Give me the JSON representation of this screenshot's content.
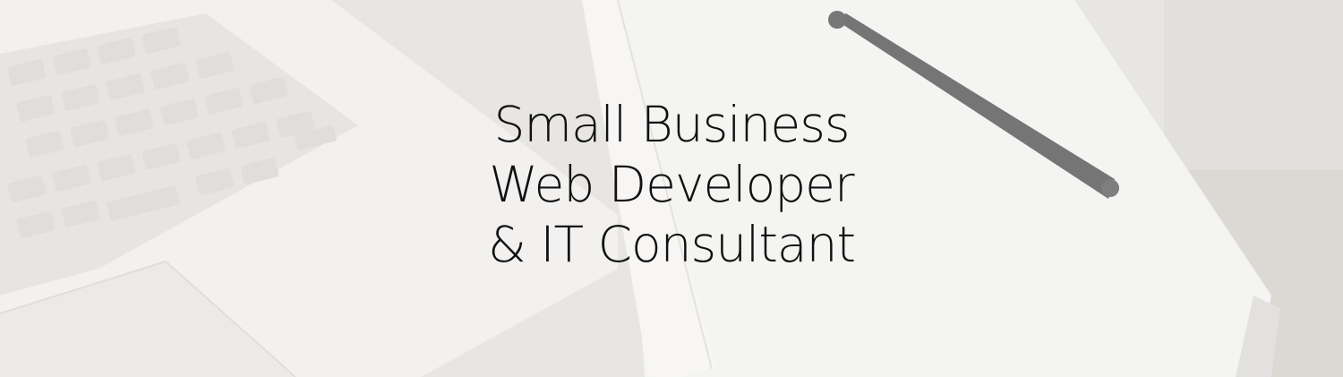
{
  "hero": {
    "headline_lines": [
      "Small Business",
      "Web Developer",
      "& IT Consultant"
    ]
  },
  "colors": {
    "text": "#111111",
    "background": "#e9e8e6"
  },
  "images": {
    "background": "desk-with-laptop-notebook-and-pen-photo"
  }
}
